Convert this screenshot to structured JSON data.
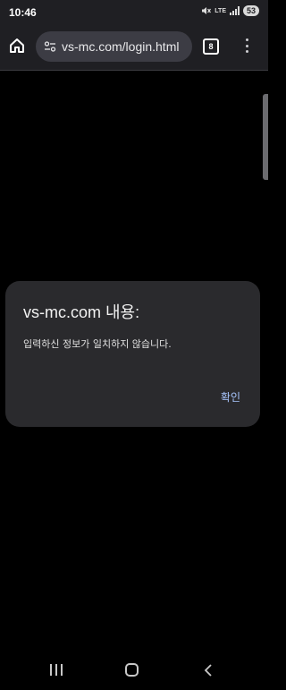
{
  "status_bar": {
    "time": "10:46",
    "network_label": "LTE",
    "battery": "53"
  },
  "browser": {
    "url": "vs-mc.com/login.html",
    "tab_count": "8"
  },
  "dialog": {
    "title": "vs-mc.com 내용:",
    "message": "입력하신 정보가 일치하지 않습니다.",
    "ok_label": "확인"
  },
  "colors": {
    "background": "#000000",
    "toolbar": "#1f1f23",
    "dialog": "#2a2a2d",
    "accent": "#a9c7ff"
  },
  "icons": [
    "home-icon",
    "site-settings-icon",
    "more-vert-icon",
    "mute-icon",
    "signal-icon",
    "recent-apps-icon",
    "nav-home-icon",
    "nav-back-icon"
  ]
}
